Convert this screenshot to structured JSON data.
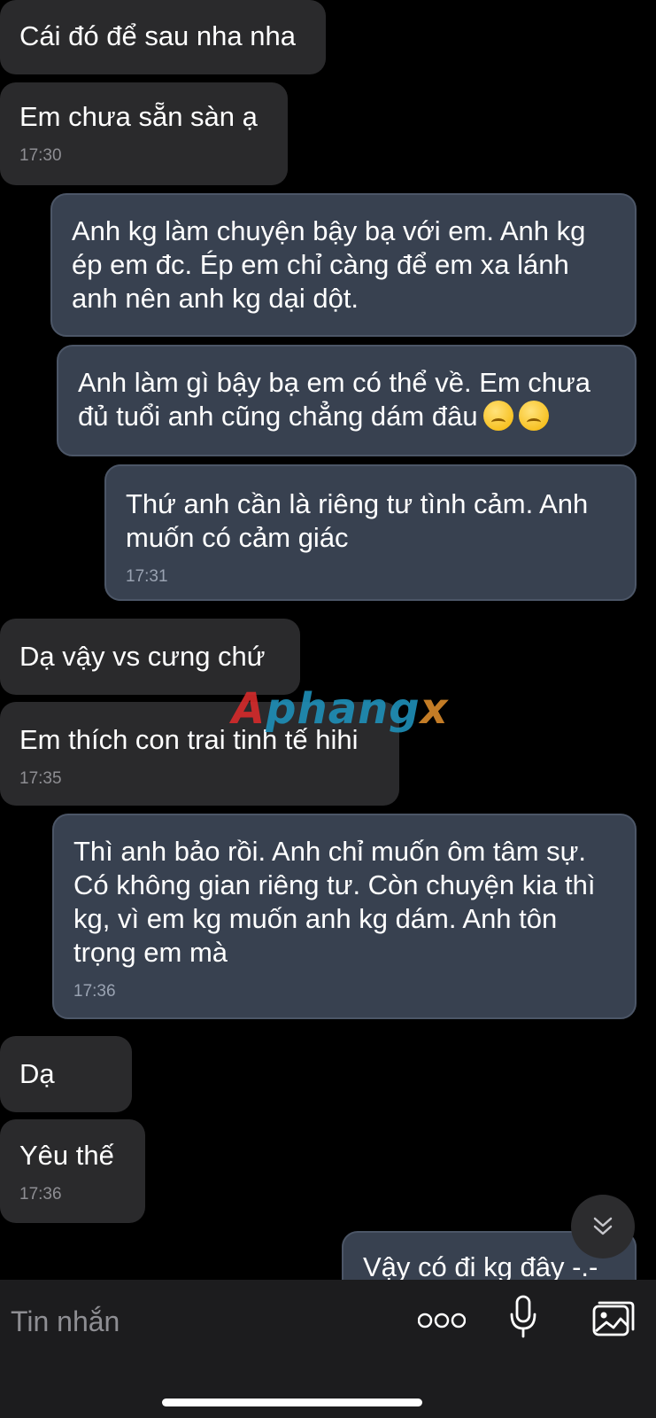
{
  "messages": [
    {
      "direction": "incoming",
      "text": "Cái đó để sau nha nha",
      "time": ""
    },
    {
      "direction": "incoming",
      "text": "Em chưa sẵn sàn ạ",
      "time": "17:30"
    },
    {
      "direction": "outgoing",
      "text": "Anh kg làm chuyện bậy bạ với em. Anh kg ép em đc. Ép em chỉ càng để em xa lánh anh nên anh kg dại dột.",
      "time": ""
    },
    {
      "direction": "outgoing",
      "text": "Anh làm gì bậy bạ em có thể về. Em chưa đủ tuổi anh cũng chẳng dám đâu",
      "time": ""
    },
    {
      "direction": "outgoing",
      "text": "Thứ anh cần là riêng tư tình cảm. Anh muốn có cảm giác",
      "time": "17:31"
    },
    {
      "direction": "incoming",
      "text": "Dạ vậy vs cưng chứ",
      "time": ""
    },
    {
      "direction": "incoming",
      "text": "Em thích con trai tinh tế hihi",
      "time": "17:35"
    },
    {
      "direction": "outgoing",
      "text": "Thì anh bảo rồi. Anh chỉ muốn ôm tâm sự. Có không gian riêng tư. Còn chuyện kia thì kg, vì em kg muốn anh kg dám. Anh tôn trọng em mà",
      "time": "17:36"
    },
    {
      "direction": "incoming",
      "text": "Dạ",
      "time": ""
    },
    {
      "direction": "incoming",
      "text": "Yêu thế",
      "time": "17:36"
    },
    {
      "direction": "outgoing",
      "text": "Vậy có đi kg đây -.-",
      "time": ""
    }
  ],
  "watermark": {
    "part1": "A",
    "part2": "phang",
    "part3": "x"
  },
  "composer": {
    "placeholder": "Tin nhắn"
  },
  "icons": {
    "scroll_down": "double-chevron-down-icon",
    "more": "more-dots-icon",
    "mic": "microphone-icon",
    "gallery": "image-gallery-icon",
    "emoji": [
      "anxious-face-emoji",
      "crying-face-emoji"
    ]
  },
  "colors": {
    "background": "#000000",
    "incoming_bubble": "#2a2a2c",
    "outgoing_bubble": "#384150",
    "timestamp": "#8e8e93"
  }
}
